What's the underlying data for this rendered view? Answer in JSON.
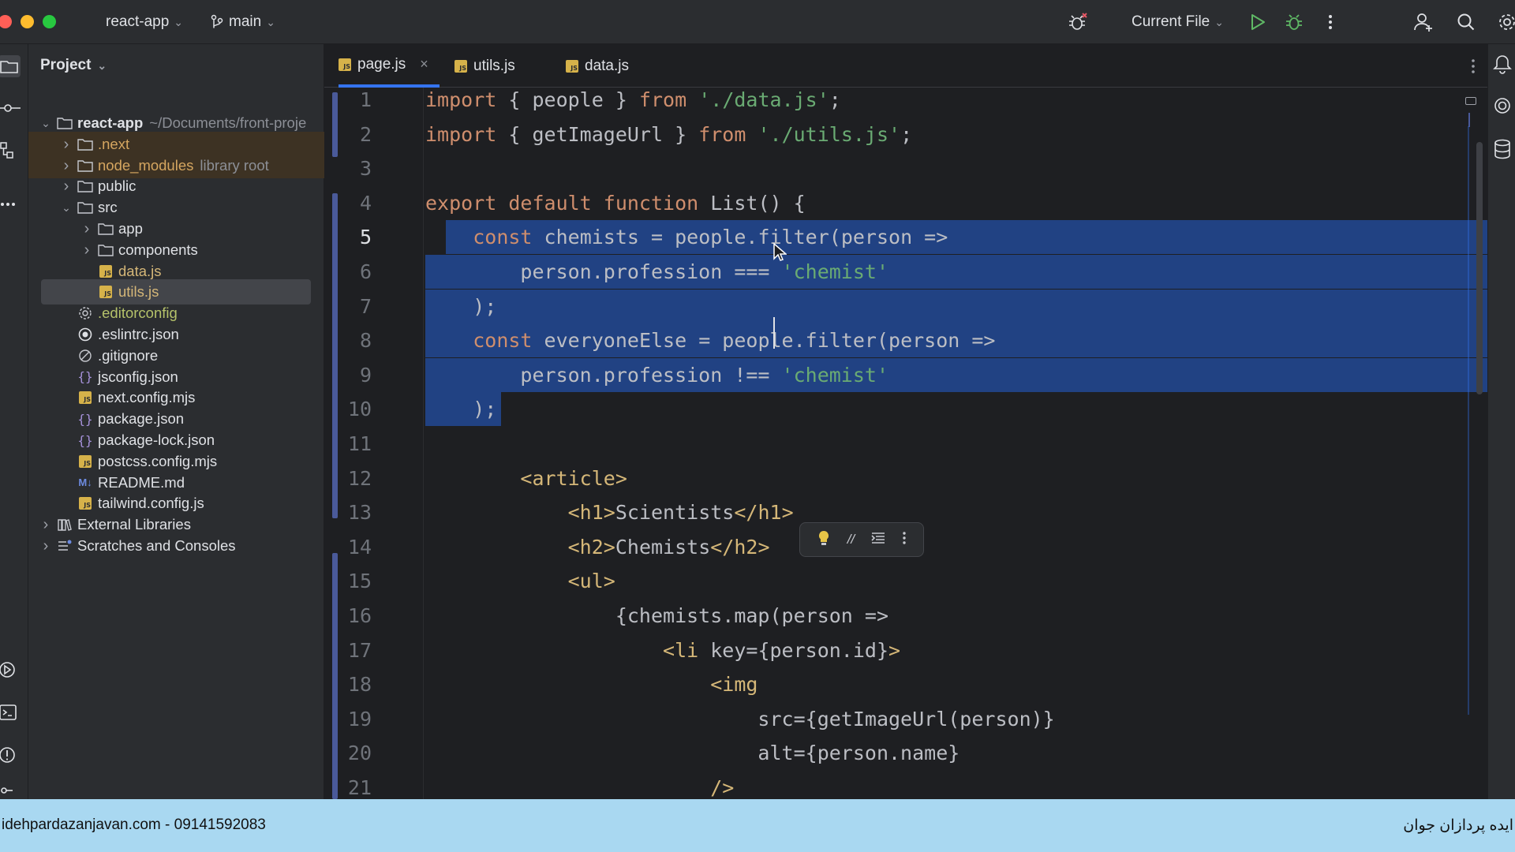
{
  "titlebar": {
    "project_name": "react-app",
    "branch": "main",
    "run_config": "Current File",
    "colors": {
      "close": "#ff5f57",
      "minimize": "#febc2e",
      "maximize": "#28c840"
    }
  },
  "project_panel": {
    "title": "Project",
    "tree": [
      {
        "name": "react-app",
        "hint": "~/Documents/front-proje",
        "type": "folder",
        "expanded": true
      },
      {
        "name": ".next",
        "type": "folder",
        "expanded": false,
        "excluded": true
      },
      {
        "name": "node_modules",
        "hint": "library root",
        "type": "folder",
        "expanded": false,
        "excluded": true
      },
      {
        "name": "public",
        "type": "folder",
        "expanded": false
      },
      {
        "name": "src",
        "type": "folder",
        "expanded": true
      },
      {
        "name": "app",
        "type": "folder",
        "expanded": false
      },
      {
        "name": "components",
        "type": "folder",
        "expanded": false
      },
      {
        "name": "data.js",
        "type": "js"
      },
      {
        "name": "utils.js",
        "type": "js",
        "selected": true
      },
      {
        "name": ".editorconfig",
        "type": "config"
      },
      {
        "name": ".eslintrc.json",
        "type": "eslint"
      },
      {
        "name": ".gitignore",
        "type": "ignore"
      },
      {
        "name": "jsconfig.json",
        "type": "json"
      },
      {
        "name": "next.config.mjs",
        "type": "js"
      },
      {
        "name": "package.json",
        "type": "json"
      },
      {
        "name": "package-lock.json",
        "type": "json"
      },
      {
        "name": "postcss.config.mjs",
        "type": "js"
      },
      {
        "name": "README.md",
        "type": "md"
      },
      {
        "name": "tailwind.config.js",
        "type": "js"
      },
      {
        "name": "External Libraries",
        "type": "libs",
        "expanded": false
      },
      {
        "name": "Scratches and Consoles",
        "type": "scratch",
        "expanded": false
      }
    ]
  },
  "tabs": [
    {
      "label": "page.js",
      "active": true
    },
    {
      "label": "utils.js",
      "active": false
    },
    {
      "label": "data.js",
      "active": false
    }
  ],
  "editor": {
    "current_line": "5",
    "lines": [
      {
        "n": "1",
        "html": "<span class=\"kw\">import</span> { people } <span class=\"kw\">from</span> <span class=\"str\">'./data.js'</span>;"
      },
      {
        "n": "2",
        "html": "<span class=\"kw\">import</span> { getImageUrl } <span class=\"kw\">from</span> <span class=\"str\">'./utils.js'</span>;"
      },
      {
        "n": "3",
        "html": ""
      },
      {
        "n": "4",
        "html": "<span class=\"kw\">export default function</span> List() {"
      },
      {
        "n": "5",
        "html": "    <span class=\"kw\">const</span> chemists = people.filter(person =>",
        "sel": true
      },
      {
        "n": "6",
        "html": "        person.profession === <span class=\"str\">'chemist'</span>",
        "sel": true
      },
      {
        "n": "7",
        "html": "    );",
        "sel": true
      },
      {
        "n": "8",
        "html": "    <span class=\"kw\">const</span> everyoneElse = people.filter(person =>",
        "sel": true
      },
      {
        "n": "9",
        "html": "        person.profession !== <span class=\"str\">'chemist'</span>",
        "sel": true
      },
      {
        "n": "10",
        "html": "    );",
        "sel": "partial"
      },
      {
        "n": "11",
        "html": ""
      },
      {
        "n": "12",
        "html": "        <span class=\"tag\">&lt;article&gt;</span>"
      },
      {
        "n": "13",
        "html": "            <span class=\"tag\">&lt;h1&gt;</span>Scientists<span class=\"tag\">&lt;/h1&gt;</span>"
      },
      {
        "n": "14",
        "html": "            <span class=\"tag\">&lt;h2&gt;</span>Chemists<span class=\"tag\">&lt;/h2&gt;</span>"
      },
      {
        "n": "15",
        "html": "            <span class=\"tag\">&lt;ul&gt;</span>"
      },
      {
        "n": "16",
        "html": "                {chemists.map(person =>"
      },
      {
        "n": "17",
        "html": "                    <span class=\"tag\">&lt;li</span> key={person.id}<span class=\"tag\">&gt;</span>"
      },
      {
        "n": "18",
        "html": "                        <span class=\"tag\">&lt;img</span>"
      },
      {
        "n": "19",
        "html": "                            src={getImageUrl(person)}"
      },
      {
        "n": "20",
        "html": "                            alt={person.name}"
      },
      {
        "n": "21",
        "html": "                        <span class=\"tag\">/&gt;</span>"
      }
    ]
  },
  "footer": {
    "left_text": "idehpardazanjavan.com - 09141592083",
    "right_text": "ایده پردازان جوان"
  }
}
